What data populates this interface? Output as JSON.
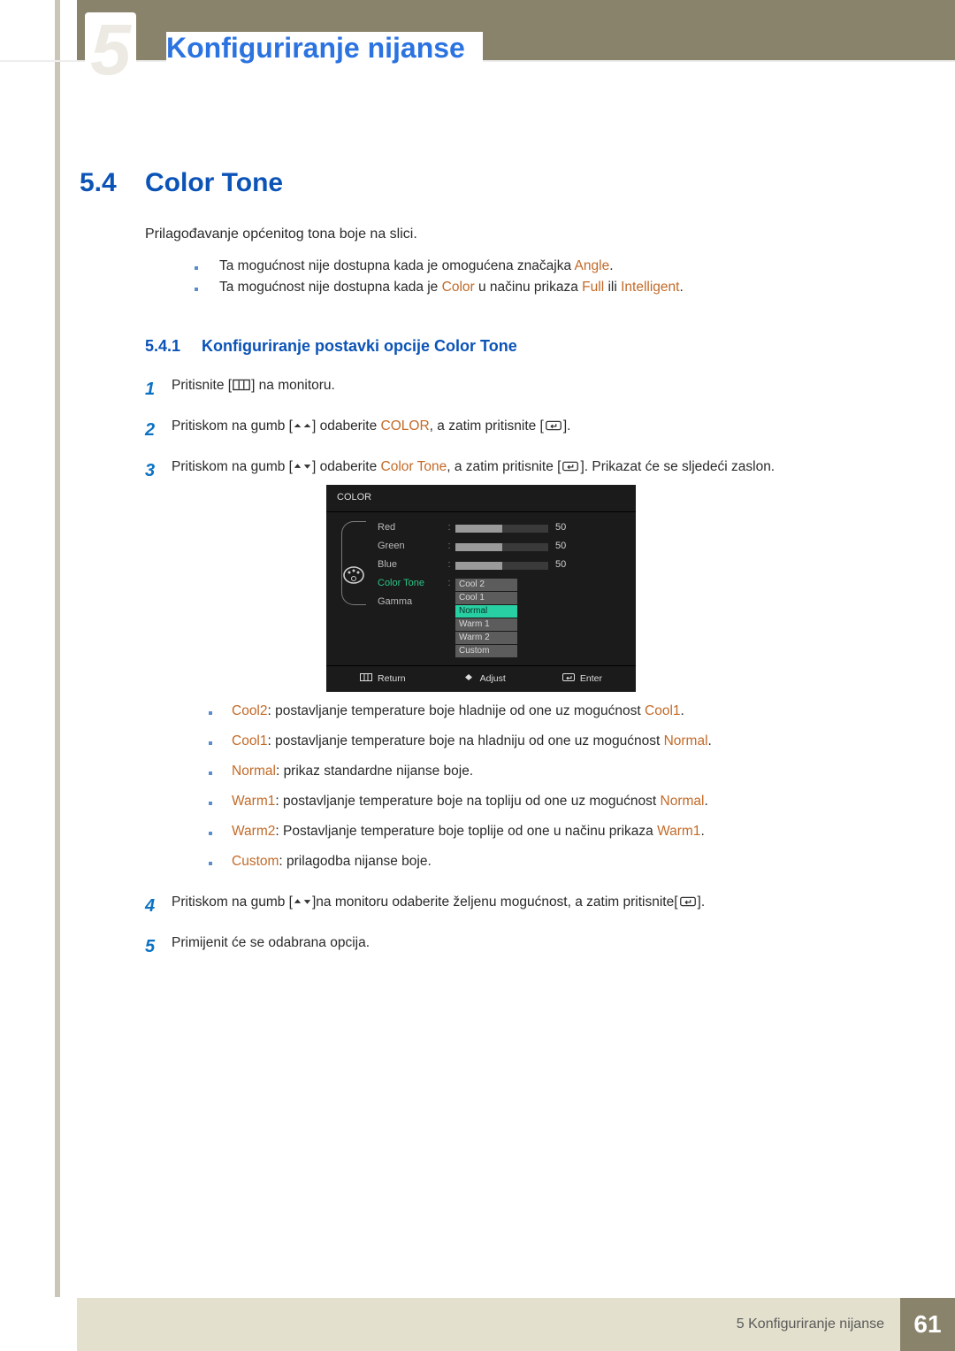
{
  "header": {
    "chapter_number": "5",
    "chapter_title": "Konfiguriranje nijanse"
  },
  "section": {
    "number": "5.4",
    "title": "Color Tone",
    "intro": "Prilagođavanje općenitog tona boje na slici.",
    "notes": [
      {
        "pre": "Ta mogućnost nije dostupna kada je omogućena značajka ",
        "hl": "Angle",
        "post": "."
      },
      {
        "pre": "Ta mogućnost nije dostupna kada je ",
        "hl": "Color",
        "mid": " u načinu prikaza ",
        "hl2": "Full",
        "mid2": " ili ",
        "hl3": "Intelligent",
        "post": "."
      }
    ]
  },
  "subsection": {
    "number": "5.4.1",
    "title": "Konfiguriranje postavki opcije Color Tone"
  },
  "steps": {
    "s1": {
      "num": "1",
      "pre": "Pritisnite [",
      "post": "] na monitoru."
    },
    "s2": {
      "num": "2",
      "pre": "Pritiskom na gumb [",
      "mid": "] odaberite ",
      "hl1": "COLOR",
      "mid2": ", a zatim pritisnite [",
      "end": "]."
    },
    "s3": {
      "num": "3",
      "pre": "Pritiskom na gumb [",
      "mid": "] odaberite ",
      "hl1": "Color Tone",
      "mid2": ", a zatim pritisnite [",
      "end": "]. Prikazat će se sljedeći zaslon."
    },
    "s4": {
      "num": "4",
      "pre": "Pritiskom na gumb [",
      "mid": "]na monitoru odaberite željenu mogućnost, a zatim pritisnite[",
      "end": "]."
    },
    "s5": {
      "num": "5",
      "text": "Primijenit će se odabrana opcija."
    }
  },
  "osd": {
    "title": "COLOR",
    "rows": {
      "red": {
        "label": "Red",
        "value": "50"
      },
      "green": {
        "label": "Green",
        "value": "50"
      },
      "blue": {
        "label": "Blue",
        "value": "50"
      },
      "colortone": {
        "label": "Color Tone"
      },
      "gamma": {
        "label": "Gamma"
      }
    },
    "options": [
      "Cool 2",
      "Cool 1",
      "Normal",
      "Warm 1",
      "Warm 2",
      "Custom"
    ],
    "selected_option": "Normal",
    "footer": {
      "return": "Return",
      "adjust": "Adjust",
      "enter": "Enter"
    }
  },
  "tone_descriptions": [
    {
      "hl": "Cool2",
      "text": ": postavljanje temperature boje hladnije od one uz mogućnost ",
      "hl2": "Cool1",
      "post": "."
    },
    {
      "hl": "Cool1",
      "text": ": postavljanje temperature boje na hladniju od one uz mogućnost ",
      "hl2": "Normal",
      "post": "."
    },
    {
      "hl": "Normal",
      "text": ": prikaz standardne nijanse boje.",
      "hl2": "",
      "post": ""
    },
    {
      "hl": "Warm1",
      "text": ": postavljanje temperature boje na topliju od one uz mogućnost ",
      "hl2": "Normal",
      "post": "."
    },
    {
      "hl": "Warm2",
      "text": ": Postavljanje temperature boje toplije od one u načinu prikaza ",
      "hl2": "Warm1",
      "post": "."
    },
    {
      "hl": "Custom",
      "text": ": prilagodba nijanse boje.",
      "hl2": "",
      "post": ""
    }
  ],
  "footer": {
    "text": "5 Konfiguriranje nijanse",
    "page": "61"
  }
}
